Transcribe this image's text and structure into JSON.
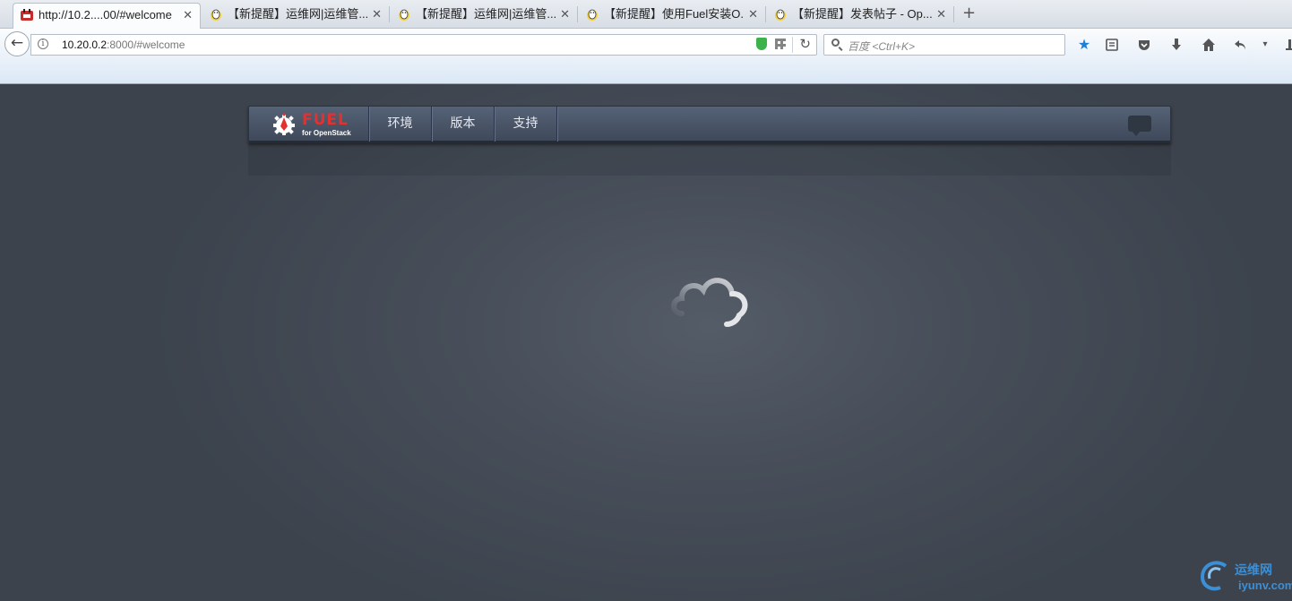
{
  "browser": {
    "tabs": [
      {
        "title": "http://10.2....00/#welcome",
        "active": true,
        "icon": "fuel-favicon"
      },
      {
        "title": "【新提醒】运维网|运维管...",
        "active": false,
        "icon": "penguin-favicon"
      },
      {
        "title": "【新提醒】运维网|运维管...",
        "active": false,
        "icon": "penguin-favicon"
      },
      {
        "title": "【新提醒】使用Fuel安装O...",
        "active": false,
        "icon": "penguin-favicon"
      },
      {
        "title": "【新提醒】发表帖子 - Op...",
        "active": false,
        "icon": "penguin-favicon"
      }
    ],
    "close_glyph": "✕",
    "new_tab_glyph": "+",
    "url_host": "10.20.0.2",
    "url_rest": ":8000/#welcome",
    "search_placeholder": "百度 <Ctrl+K>",
    "toolbar_icons": [
      "bookmark-star-icon",
      "reading-list-icon",
      "pocket-icon",
      "download-icon",
      "home-icon",
      "undo-icon",
      "dropdown-icon"
    ]
  },
  "app": {
    "logo_word": "FUEL",
    "logo_sub": "for OpenStack",
    "nav": [
      {
        "label": "环境"
      },
      {
        "label": "版本"
      },
      {
        "label": "支持"
      }
    ],
    "accent": "#e3312f"
  },
  "watermark": {
    "cn": "运维网",
    "en": "iyunv.com",
    "color": "#3b8fd6"
  }
}
